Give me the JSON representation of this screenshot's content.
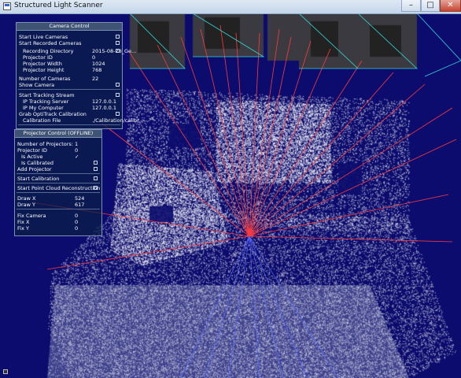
{
  "window": {
    "title": "Structured Light Scanner"
  },
  "camera_control": {
    "title": "Camera Control",
    "rows": [
      {
        "label": "Start Live Cameras",
        "kind": "check"
      },
      {
        "label": "Start Recorded Cameras",
        "kind": "check"
      },
      {
        "label": "Recording Directory",
        "value": "2015-08-28_Ge...",
        "kind": "value-check"
      },
      {
        "label": "Projector ID",
        "value": "0",
        "kind": "value"
      },
      {
        "label": "Projector Width",
        "value": "1024",
        "kind": "value"
      },
      {
        "label": "Projector Height",
        "value": "768",
        "kind": "value"
      },
      {
        "label": "Number of Cameras",
        "value": "22",
        "kind": "value"
      },
      {
        "label": "Show Camera",
        "kind": "check"
      },
      {
        "label": "Start Tracking Stream",
        "kind": "check"
      },
      {
        "label": "IP Tracking Server",
        "value": "127.0.0.1",
        "kind": "value"
      },
      {
        "label": "IP My Computer",
        "value": "127.0.0.1",
        "kind": "value"
      },
      {
        "label": "Grab OptiTrack Calibration",
        "kind": "check"
      },
      {
        "label": "Calibration File",
        "value": "./Calibration/calibr...",
        "kind": "value"
      }
    ]
  },
  "projector_control": {
    "title": "Projector Control (OFFLINE)",
    "rows": [
      {
        "label": "Number of Projectors:",
        "value": "1",
        "kind": "value"
      },
      {
        "label": "Projector ID",
        "value": "0",
        "kind": "value"
      },
      {
        "label": "Is Active",
        "value": "✓",
        "kind": "value"
      },
      {
        "label": "Is Calibrated",
        "kind": "check"
      },
      {
        "label": "Add Projector",
        "kind": "check"
      },
      {
        "label": "Start Calibration",
        "kind": "check"
      },
      {
        "label": "Start Point Cloud Reconstruction",
        "kind": "check"
      },
      {
        "label": "Draw X",
        "value": "524",
        "kind": "value"
      },
      {
        "label": "Draw Y",
        "value": "617",
        "kind": "value"
      },
      {
        "label": "Fix Camera",
        "value": "0",
        "kind": "value"
      },
      {
        "label": "Fix X",
        "value": "0",
        "kind": "value"
      },
      {
        "label": "Fix Y",
        "value": "0",
        "kind": "value"
      }
    ]
  },
  "colors": {
    "background": "#0c0c6e",
    "point_cloud": "#ffffff",
    "projection_rays": "#ff3b3b",
    "camera_frustums": "#33d6d6"
  }
}
